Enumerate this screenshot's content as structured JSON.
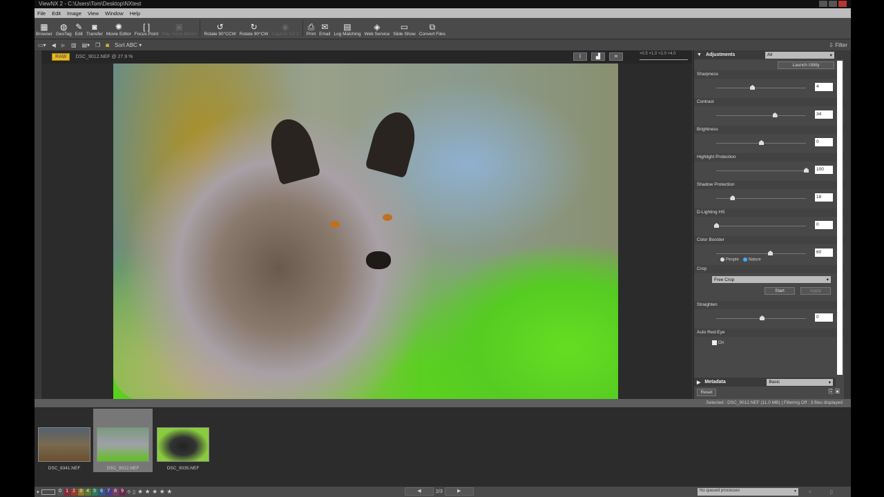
{
  "window": {
    "title": "ViewNX 2 - C:\\Users\\Tom\\Desktop\\NXtest"
  },
  "menu": [
    "File",
    "Edit",
    "Image",
    "View",
    "Window",
    "Help"
  ],
  "toolbar": [
    {
      "label": "Browser",
      "icon": "▦",
      "enabled": true
    },
    {
      "label": "GeoTag",
      "icon": "◍",
      "enabled": true
    },
    {
      "label": "Edit",
      "icon": "✎",
      "enabled": true
    },
    {
      "label": "Transfer",
      "icon": "◙",
      "enabled": true
    },
    {
      "label": "Movie Editor",
      "icon": "✺",
      "enabled": true
    },
    {
      "label": "Focus Point",
      "icon": "[ ]",
      "enabled": true
    },
    {
      "label": "Play Voice Memo",
      "icon": "▣",
      "enabled": false
    },
    {
      "label": "Rotate 90°CCW",
      "icon": "↺",
      "enabled": true
    },
    {
      "label": "Rotate 90°CW",
      "icon": "↻",
      "enabled": true
    },
    {
      "label": "Capture NX 2",
      "icon": "◉",
      "enabled": false
    },
    {
      "label": "Print",
      "icon": "⎙",
      "enabled": true
    },
    {
      "label": "Email",
      "icon": "✉",
      "enabled": true
    },
    {
      "label": "Log Matching",
      "icon": "▤",
      "enabled": true
    },
    {
      "label": "Web Service",
      "icon": "◈",
      "enabled": true
    },
    {
      "label": "Slide Show",
      "icon": "▭",
      "enabled": true
    },
    {
      "label": "Convert Files",
      "icon": "⧉",
      "enabled": true
    }
  ],
  "toolbar2": {
    "sort": "Sort ABC ▾",
    "filter": "Filter"
  },
  "viewer": {
    "badge": "RAW",
    "filename": "DSC_9012.NEF @ 27.9 %",
    "zoom_marks": [
      "×0.5",
      "×1.0",
      "×2.0",
      "×4.0"
    ]
  },
  "panel": {
    "header": "Adjustments",
    "filter": "All",
    "launch": "Launch Utility",
    "sliders": [
      {
        "label": "Sharpness",
        "value": "4",
        "pos": 0.4
      },
      {
        "label": "Contrast",
        "value": "34",
        "pos": 0.65
      },
      {
        "label": "Brightness",
        "value": "0",
        "pos": 0.5
      },
      {
        "label": "Highlight Protection",
        "value": "100",
        "pos": 1.0
      },
      {
        "label": "Shadow Protection",
        "value": "18",
        "pos": 0.18
      },
      {
        "label": "D-Lighting HS",
        "value": "0",
        "pos": 0.0
      },
      {
        "label": "Color Booster",
        "value": "60",
        "pos": 0.6
      }
    ],
    "radios": [
      "People",
      "Nature"
    ],
    "crop": {
      "label": "Crop",
      "value": "Free Crop",
      "start": "Start",
      "apply": "Apply"
    },
    "straighten": {
      "label": "Straighten",
      "value": "0",
      "pos": 0.5
    },
    "redeye": {
      "label": "Auto Red-Eye",
      "checkbox": "On"
    },
    "metadata": {
      "label": "Metadata",
      "value": "Basic"
    },
    "reset": "Reset"
  },
  "status": "Selected : DSC_9012.NEF (11.0 MB) | Filtering Off : 3 files displayed",
  "thumbs": [
    {
      "name": "DSC_8341.NEF"
    },
    {
      "name": "DSC_9012.NEF"
    },
    {
      "name": "DSC_9035.NEF"
    }
  ],
  "bottom": {
    "labels": [
      "0",
      "1",
      "2",
      "3",
      "4",
      "5",
      "6",
      "7",
      "8",
      "9"
    ],
    "label_colors": [
      "#555",
      "#8a2a3a",
      "#9a3a2a",
      "#8a7a2a",
      "#5a7a2a",
      "#2a7a5a",
      "#2a5a8a",
      "#4a3a8a",
      "#7a3a6a",
      "#6a2a4a"
    ],
    "page": "2/3",
    "queue": "No queued processes"
  }
}
